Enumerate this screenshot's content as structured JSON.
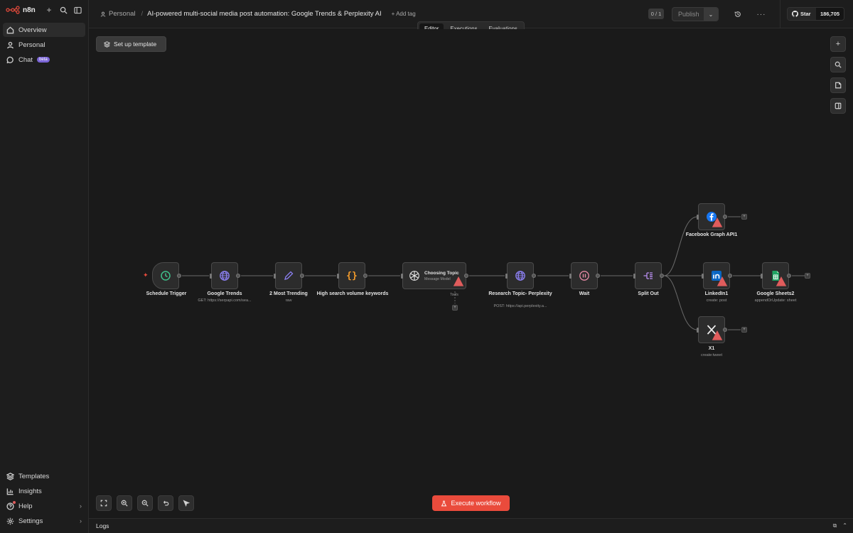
{
  "app": {
    "logo_text": "n8n"
  },
  "sidebar": {
    "items": [
      {
        "label": "Overview",
        "icon": "home-icon"
      },
      {
        "label": "Personal",
        "icon": "user-icon"
      },
      {
        "label": "Chat",
        "icon": "chat-icon",
        "badge": "beta"
      }
    ],
    "bottom_items": [
      {
        "label": "Templates",
        "icon": "template-icon"
      },
      {
        "label": "Insights",
        "icon": "insights-icon"
      },
      {
        "label": "Help",
        "icon": "help-icon"
      },
      {
        "label": "Settings",
        "icon": "settings-icon"
      }
    ]
  },
  "header": {
    "breadcrumb_project": "Personal",
    "workflow_title": "AI-powered multi-social media post automation: Google Trends & Perplexity AI",
    "add_tag": "+ Add tag",
    "counter": "0 / 1",
    "publish_label": "Publish",
    "github_star_label": "Star",
    "github_star_count": "186,705"
  },
  "tabs": [
    "Editor",
    "Executions",
    "Evaluations"
  ],
  "canvas": {
    "setup_template_label": "Set up template",
    "execute_label": "Execute workflow"
  },
  "logs": {
    "label": "Logs"
  },
  "nodes": {
    "schedule": {
      "label": "Schedule Trigger"
    },
    "google_trends": {
      "label": "Google Trends",
      "sub": "GET: https://serpapi.com/sea..."
    },
    "trending": {
      "label": "2 Most Trending",
      "sub": "raw"
    },
    "keywords": {
      "label": "High search volume keywords"
    },
    "choosing": {
      "label": "Choosing Topic",
      "sub": "Message Model",
      "tools_label": "Tools"
    },
    "research": {
      "label": "Research Topic- Perplexity",
      "sub": "POST: https://api.perplexity.a..."
    },
    "wait": {
      "label": "Wait"
    },
    "split": {
      "label": "Split Out"
    },
    "facebook": {
      "label": "Facebook Graph API1"
    },
    "linkedin": {
      "label": "LinkedIn1",
      "sub": "create: post"
    },
    "sheets": {
      "label": "Google Sheets2",
      "sub": "appendOrUpdate: sheet"
    },
    "x1": {
      "label": "X1",
      "sub": "create:tweet"
    }
  },
  "colors": {
    "accent": "#ea4b3c",
    "beta_badge": "#7b65d6",
    "trigger_green": "#3fbf8a",
    "globe_purple": "#8b7ff0",
    "code_orange": "#f39c2c",
    "facebook_blue": "#1877f2",
    "linkedin_blue": "#0a66c2",
    "sheets_green": "#1fa463"
  }
}
